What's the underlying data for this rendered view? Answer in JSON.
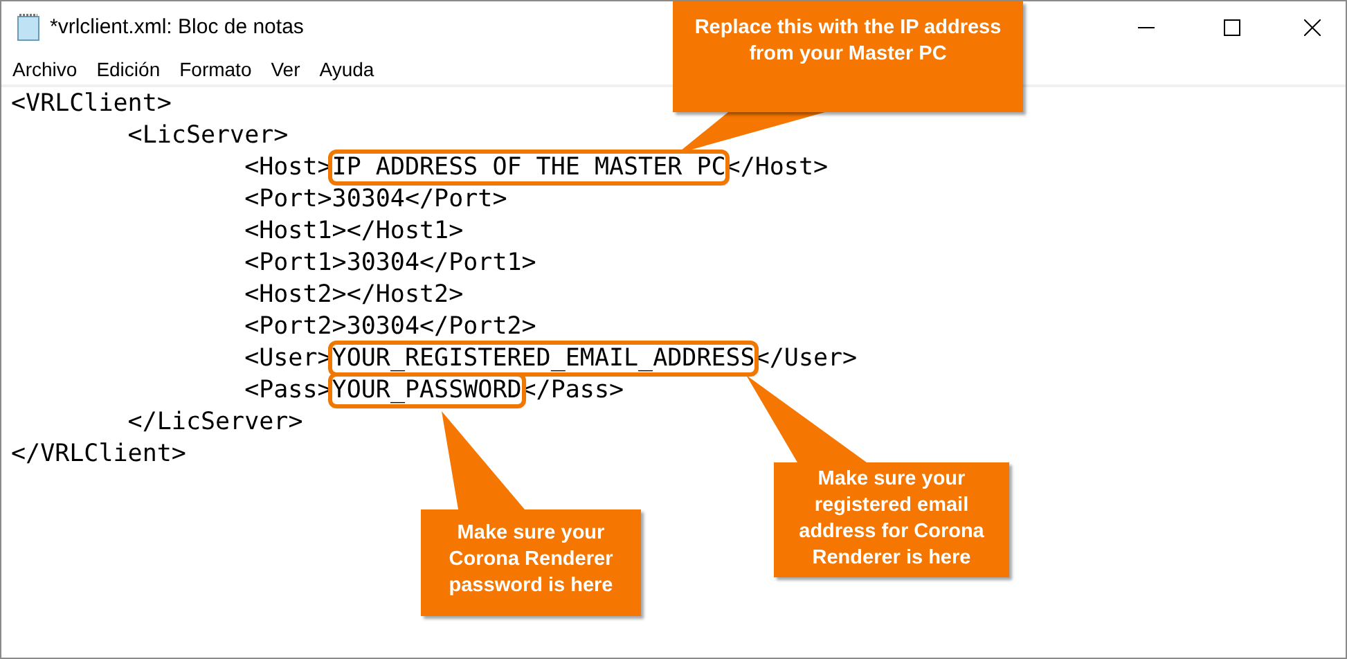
{
  "window": {
    "title": "*vrlclient.xml: Bloc de notas"
  },
  "menu": [
    "Archivo",
    "Edición",
    "Formato",
    "Ver",
    "Ayuda"
  ],
  "lines": [
    [
      {
        "text": "<VRLClient>",
        "highlighted": false
      }
    ],
    [
      {
        "text": "\t<LicServer>",
        "highlighted": false
      }
    ],
    [
      {
        "text": "\t\t<Host>",
        "highlighted": false
      },
      {
        "text": "IP ADDRESS OF THE MASTER PC",
        "highlighted": true
      },
      {
        "text": "</Host>",
        "highlighted": false
      }
    ],
    [
      {
        "text": "\t\t<Port>30304</Port>",
        "highlighted": false
      }
    ],
    [
      {
        "text": "\t\t<Host1></Host1>",
        "highlighted": false
      }
    ],
    [
      {
        "text": "\t\t<Port1>30304</Port1>",
        "highlighted": false
      }
    ],
    [
      {
        "text": "\t\t<Host2></Host2>",
        "highlighted": false
      }
    ],
    [
      {
        "text": "\t\t<Port2>30304</Port2>",
        "highlighted": false
      }
    ],
    [
      {
        "text": "\t\t<User>",
        "highlighted": false
      },
      {
        "text": "YOUR_REGISTERED_EMAIL_ADDRESS",
        "highlighted": true
      },
      {
        "text": "</User>",
        "highlighted": false
      }
    ],
    [
      {
        "text": "\t\t<Pass>",
        "highlighted": false
      },
      {
        "text": "YOUR_PASSWORD",
        "highlighted": true
      },
      {
        "text": "</Pass>",
        "highlighted": false
      }
    ],
    [
      {
        "text": "\t</LicServer>",
        "highlighted": false
      }
    ],
    [
      {
        "text": "</VRLClient>",
        "highlighted": false
      }
    ]
  ],
  "callouts": [
    {
      "text": "Replace this with the IP address from your Master PC"
    },
    {
      "text": "Make sure your Corona Renderer password is here"
    },
    {
      "text": "Make sure your registered email address for Corona Renderer is here"
    }
  ]
}
